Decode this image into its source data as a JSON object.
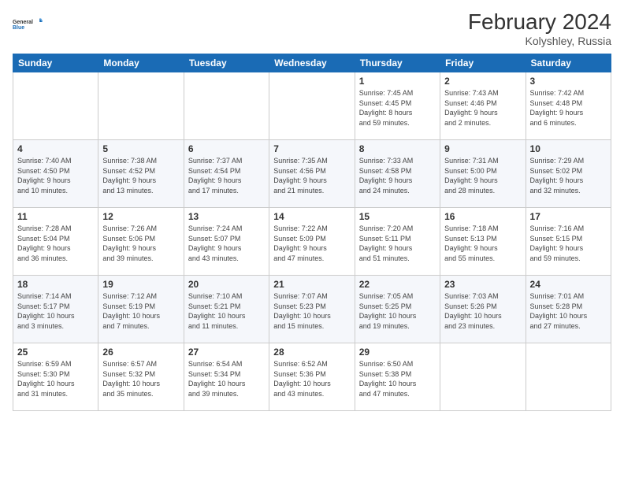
{
  "header": {
    "logo_line1": "General",
    "logo_line2": "Blue",
    "title": "February 2024",
    "subtitle": "Kolyshley, Russia"
  },
  "days_of_week": [
    "Sunday",
    "Monday",
    "Tuesday",
    "Wednesday",
    "Thursday",
    "Friday",
    "Saturday"
  ],
  "weeks": [
    [
      {
        "day": "",
        "info": ""
      },
      {
        "day": "",
        "info": ""
      },
      {
        "day": "",
        "info": ""
      },
      {
        "day": "",
        "info": ""
      },
      {
        "day": "1",
        "info": "Sunrise: 7:45 AM\nSunset: 4:45 PM\nDaylight: 8 hours\nand 59 minutes."
      },
      {
        "day": "2",
        "info": "Sunrise: 7:43 AM\nSunset: 4:46 PM\nDaylight: 9 hours\nand 2 minutes."
      },
      {
        "day": "3",
        "info": "Sunrise: 7:42 AM\nSunset: 4:48 PM\nDaylight: 9 hours\nand 6 minutes."
      }
    ],
    [
      {
        "day": "4",
        "info": "Sunrise: 7:40 AM\nSunset: 4:50 PM\nDaylight: 9 hours\nand 10 minutes."
      },
      {
        "day": "5",
        "info": "Sunrise: 7:38 AM\nSunset: 4:52 PM\nDaylight: 9 hours\nand 13 minutes."
      },
      {
        "day": "6",
        "info": "Sunrise: 7:37 AM\nSunset: 4:54 PM\nDaylight: 9 hours\nand 17 minutes."
      },
      {
        "day": "7",
        "info": "Sunrise: 7:35 AM\nSunset: 4:56 PM\nDaylight: 9 hours\nand 21 minutes."
      },
      {
        "day": "8",
        "info": "Sunrise: 7:33 AM\nSunset: 4:58 PM\nDaylight: 9 hours\nand 24 minutes."
      },
      {
        "day": "9",
        "info": "Sunrise: 7:31 AM\nSunset: 5:00 PM\nDaylight: 9 hours\nand 28 minutes."
      },
      {
        "day": "10",
        "info": "Sunrise: 7:29 AM\nSunset: 5:02 PM\nDaylight: 9 hours\nand 32 minutes."
      }
    ],
    [
      {
        "day": "11",
        "info": "Sunrise: 7:28 AM\nSunset: 5:04 PM\nDaylight: 9 hours\nand 36 minutes."
      },
      {
        "day": "12",
        "info": "Sunrise: 7:26 AM\nSunset: 5:06 PM\nDaylight: 9 hours\nand 39 minutes."
      },
      {
        "day": "13",
        "info": "Sunrise: 7:24 AM\nSunset: 5:07 PM\nDaylight: 9 hours\nand 43 minutes."
      },
      {
        "day": "14",
        "info": "Sunrise: 7:22 AM\nSunset: 5:09 PM\nDaylight: 9 hours\nand 47 minutes."
      },
      {
        "day": "15",
        "info": "Sunrise: 7:20 AM\nSunset: 5:11 PM\nDaylight: 9 hours\nand 51 minutes."
      },
      {
        "day": "16",
        "info": "Sunrise: 7:18 AM\nSunset: 5:13 PM\nDaylight: 9 hours\nand 55 minutes."
      },
      {
        "day": "17",
        "info": "Sunrise: 7:16 AM\nSunset: 5:15 PM\nDaylight: 9 hours\nand 59 minutes."
      }
    ],
    [
      {
        "day": "18",
        "info": "Sunrise: 7:14 AM\nSunset: 5:17 PM\nDaylight: 10 hours\nand 3 minutes."
      },
      {
        "day": "19",
        "info": "Sunrise: 7:12 AM\nSunset: 5:19 PM\nDaylight: 10 hours\nand 7 minutes."
      },
      {
        "day": "20",
        "info": "Sunrise: 7:10 AM\nSunset: 5:21 PM\nDaylight: 10 hours\nand 11 minutes."
      },
      {
        "day": "21",
        "info": "Sunrise: 7:07 AM\nSunset: 5:23 PM\nDaylight: 10 hours\nand 15 minutes."
      },
      {
        "day": "22",
        "info": "Sunrise: 7:05 AM\nSunset: 5:25 PM\nDaylight: 10 hours\nand 19 minutes."
      },
      {
        "day": "23",
        "info": "Sunrise: 7:03 AM\nSunset: 5:26 PM\nDaylight: 10 hours\nand 23 minutes."
      },
      {
        "day": "24",
        "info": "Sunrise: 7:01 AM\nSunset: 5:28 PM\nDaylight: 10 hours\nand 27 minutes."
      }
    ],
    [
      {
        "day": "25",
        "info": "Sunrise: 6:59 AM\nSunset: 5:30 PM\nDaylight: 10 hours\nand 31 minutes."
      },
      {
        "day": "26",
        "info": "Sunrise: 6:57 AM\nSunset: 5:32 PM\nDaylight: 10 hours\nand 35 minutes."
      },
      {
        "day": "27",
        "info": "Sunrise: 6:54 AM\nSunset: 5:34 PM\nDaylight: 10 hours\nand 39 minutes."
      },
      {
        "day": "28",
        "info": "Sunrise: 6:52 AM\nSunset: 5:36 PM\nDaylight: 10 hours\nand 43 minutes."
      },
      {
        "day": "29",
        "info": "Sunrise: 6:50 AM\nSunset: 5:38 PM\nDaylight: 10 hours\nand 47 minutes."
      },
      {
        "day": "",
        "info": ""
      },
      {
        "day": "",
        "info": ""
      }
    ]
  ]
}
